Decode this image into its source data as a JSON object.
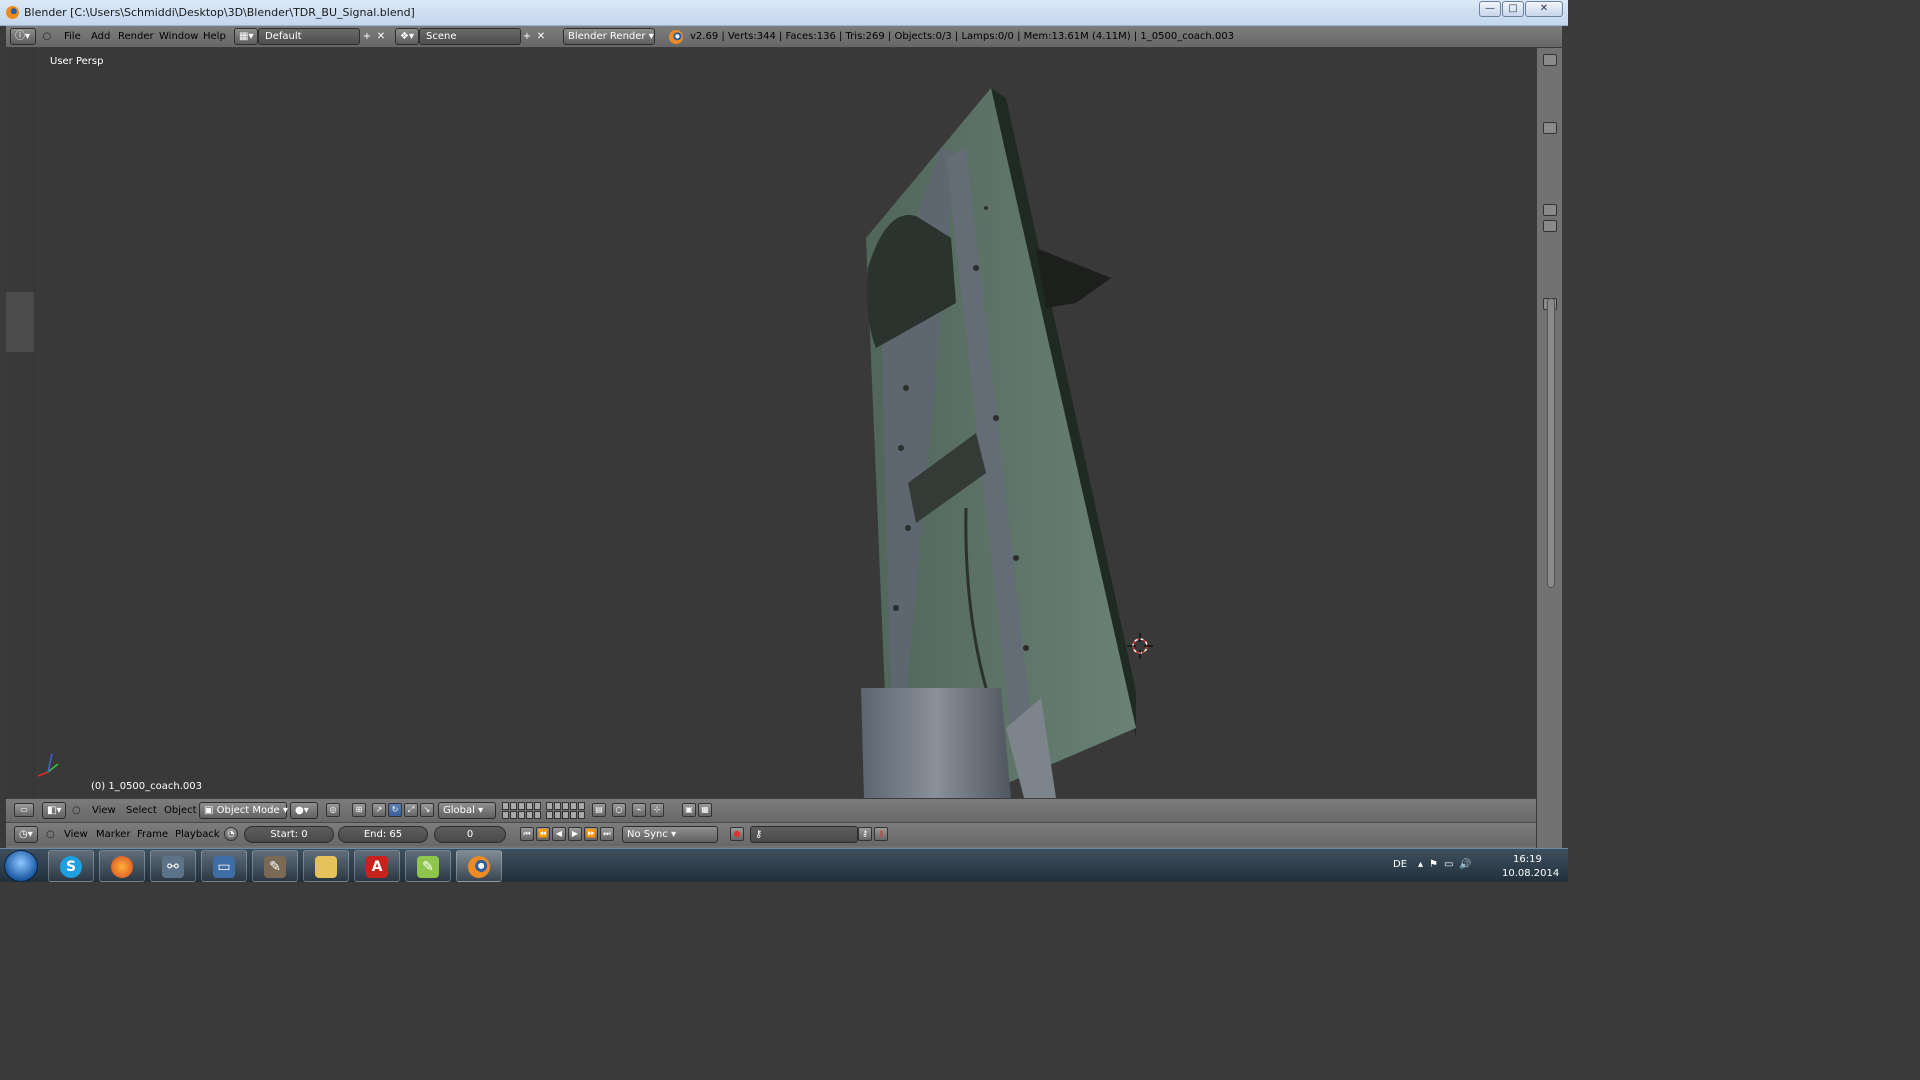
{
  "window": {
    "title": "Blender [C:\\Users\\Schmiddi\\Desktop\\3D\\Blender\\TDR_BU_Signal.blend]",
    "minimize": "—",
    "maximize": "□",
    "close": "✕"
  },
  "info_header": {
    "menus": [
      "File",
      "Add",
      "Render",
      "Window",
      "Help"
    ],
    "screen_layout": "Default",
    "scene": "Scene",
    "render_engine": "Blender Render",
    "stats": "v2.69 | Verts:344 | Faces:136 | Tris:269 | Objects:0/3 | Lamps:0/0 | Mem:13.61M (4.11M) | 1_0500_coach.003"
  },
  "viewport": {
    "view_label": "User Persp",
    "object_label": "(0) 1_0500_coach.003"
  },
  "view3d_header": {
    "menus": [
      "View",
      "Select",
      "Object"
    ],
    "mode": "Object Mode",
    "orientation": "Global"
  },
  "timeline_header": {
    "menus": [
      "View",
      "Marker",
      "Frame",
      "Playback"
    ],
    "start": "Start: 0",
    "end": "End: 65",
    "current_frame": "0",
    "sync": "No Sync"
  },
  "taskbar": {
    "apps": [
      "Skype",
      "Firefox",
      "Network",
      "Explorer Window",
      "GIMP",
      "File Explorer",
      "Adobe Reader",
      "Notepad++",
      "Blender"
    ],
    "language": "DE",
    "time": "16:19",
    "date": "10.08.2014"
  },
  "colors": {
    "viewport_bg": "#393939",
    "header_bg": "#727272",
    "accent_orange": "#ee8a23"
  }
}
